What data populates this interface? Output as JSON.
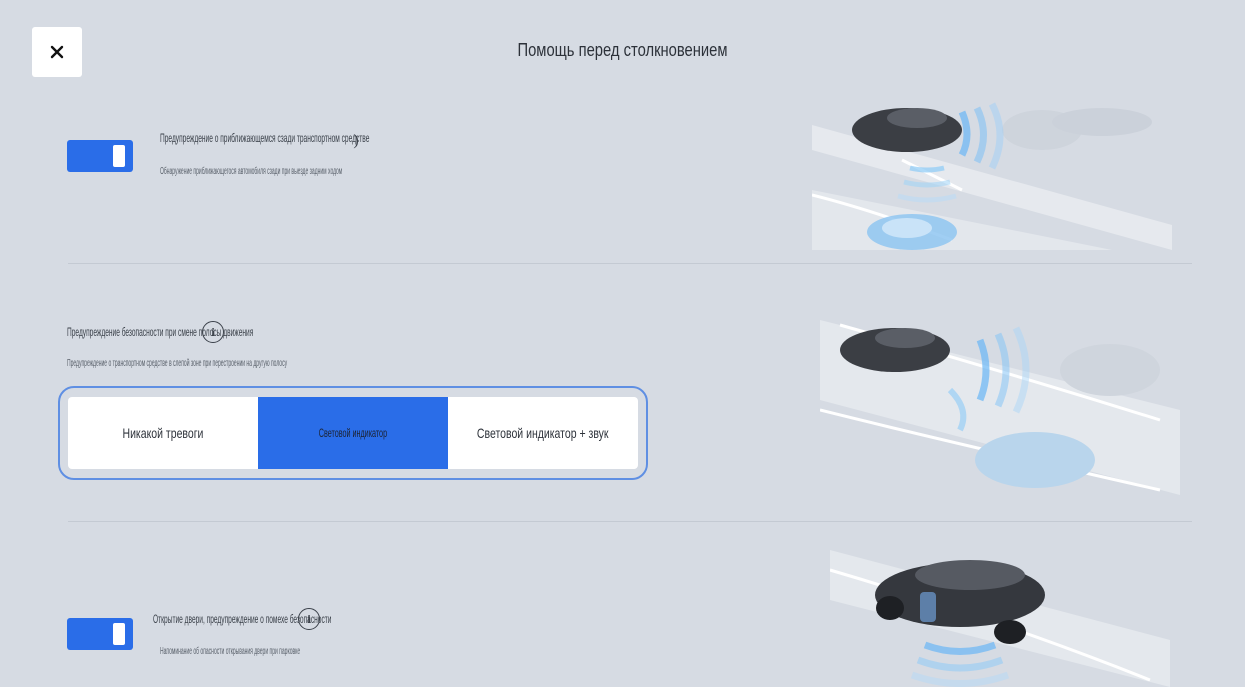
{
  "header": {
    "title": "Помощь перед столкновением",
    "close_icon": "close-icon"
  },
  "sections": [
    {
      "label": "Предупреждение о приближающемся сзади транспортном средстве",
      "info_glyph": ")",
      "description": "Обнаружение приближающегося автомобиля сзади при выезде задним ходом",
      "toggle_on": true
    },
    {
      "label": "Предупреждение безопасности при смене полосы движения",
      "info_glyph": "i",
      "description": "Предупреждение о транспортном средстве в слепой зоне при перестроении на другую полосу",
      "segmented": {
        "options": [
          "Никакой тревоги",
          "Световой индикатор",
          "Световой индикатор + звук"
        ],
        "selected": "Световой индикатор"
      }
    },
    {
      "label": "Открытие двери, предупреждение о помехе безопасности",
      "info_glyph": "i",
      "description": "Напоминание об опасности открывания двери при парковке",
      "toggle_on": true
    }
  ],
  "colors": {
    "background": "#d6dbe3",
    "accent": "#2a6de8",
    "segment_border": "#5f8fe3"
  }
}
